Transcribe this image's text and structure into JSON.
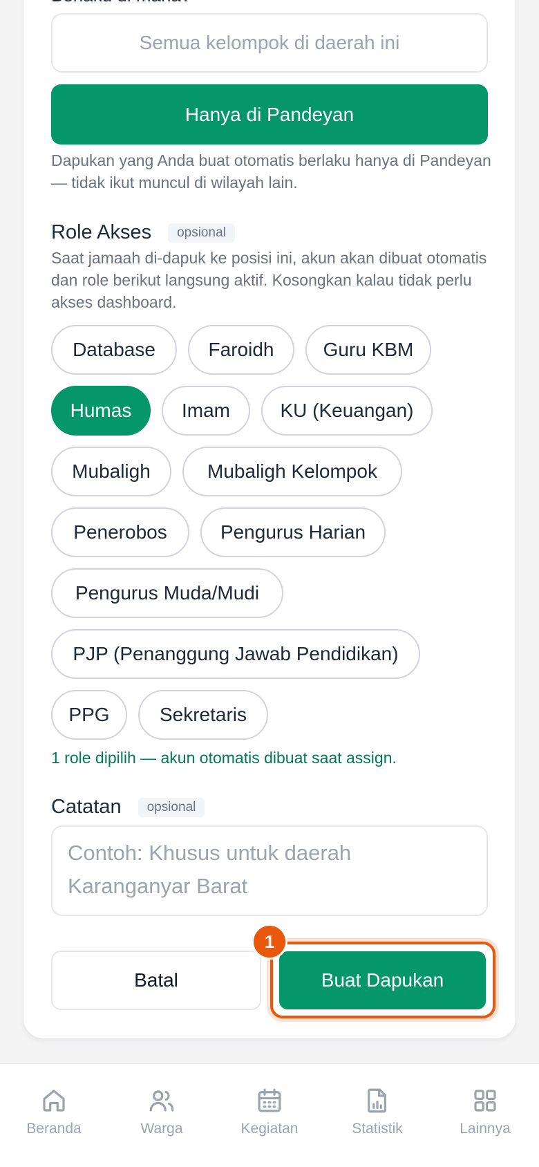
{
  "form": {
    "scope_label_partial": "Berlaku di mana?",
    "scope_options": {
      "all": "Semua kelompok di daerah ini",
      "only": "Hanya di Pandeyan"
    },
    "scope_help": "Dapukan yang Anda buat otomatis berlaku hanya di Pandeyan — tidak ikut muncul di wilayah lain.",
    "role": {
      "title": "Role Akses",
      "badge": "opsional",
      "description": "Saat jamaah di-dapuk ke posisi ini, akun akan dibuat otomatis dan role berikut langsung aktif. Kosongkan kalau tidak perlu akses dashboard.",
      "chips": [
        {
          "label": "Database",
          "selected": false
        },
        {
          "label": "Faroidh",
          "selected": false
        },
        {
          "label": "Guru KBM",
          "selected": false
        },
        {
          "label": "Humas",
          "selected": true
        },
        {
          "label": "Imam",
          "selected": false
        },
        {
          "label": "KU (Keuangan)",
          "selected": false
        },
        {
          "label": "Mubaligh",
          "selected": false
        },
        {
          "label": "Mubaligh Kelompok",
          "selected": false
        },
        {
          "label": "Penerobos",
          "selected": false
        },
        {
          "label": "Pengurus Harian",
          "selected": false
        },
        {
          "label": "Pengurus Muda/Mudi",
          "selected": false
        },
        {
          "label": "PJP (Penanggung Jawab Pendidikan)",
          "selected": false
        },
        {
          "label": "PPG",
          "selected": false
        },
        {
          "label": "Sekretaris",
          "selected": false
        }
      ],
      "selected_summary": "1 role dipilih — akun otomatis dibuat saat assign."
    },
    "notes": {
      "title": "Catatan",
      "badge": "opsional",
      "placeholder": "Contoh: Khusus untuk daerah Karanganyar Barat"
    },
    "buttons": {
      "cancel": "Batal",
      "submit": "Buat Dapukan"
    },
    "step_marker": "1"
  },
  "bottom_nav": [
    {
      "label": "Beranda",
      "icon": "home-icon"
    },
    {
      "label": "Warga",
      "icon": "users-icon"
    },
    {
      "label": "Kegiatan",
      "icon": "calendar-icon"
    },
    {
      "label": "Statistik",
      "icon": "chart-file-icon"
    },
    {
      "label": "Lainnya",
      "icon": "grid-icon"
    }
  ],
  "colors": {
    "primary": "#059669",
    "highlight": "#ea580c",
    "muted_text": "#6b7280",
    "success_text": "#047857"
  }
}
